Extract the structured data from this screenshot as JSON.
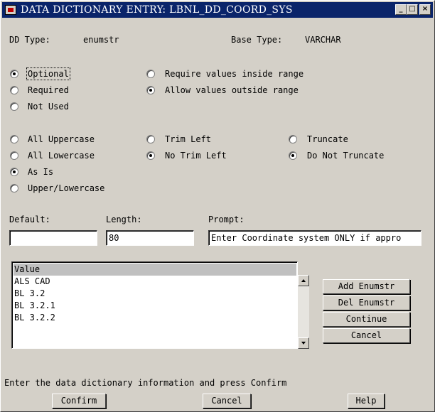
{
  "window": {
    "title": "DATA DICTIONARY ENTRY: LBNL_DD_COORD_SYS",
    "title_bar_color": "#0a246a"
  },
  "title_buttons": {
    "minimize": "_",
    "maximize": "□",
    "close": "×"
  },
  "header": {
    "dd_type_label": "DD Type:",
    "dd_type_value": "enumstr",
    "base_type_label": "Base Type:",
    "base_type_value": "VARCHAR"
  },
  "requirement": {
    "options": [
      "Optional",
      "Required",
      "Not Used"
    ],
    "selected": "Optional"
  },
  "range": {
    "options": [
      "Require values inside range",
      "Allow values outside range"
    ],
    "selected": "Allow values outside range"
  },
  "case": {
    "options": [
      "All Uppercase",
      "All Lowercase",
      "As Is",
      "Upper/Lowercase"
    ],
    "selected": "As Is"
  },
  "trim": {
    "options": [
      "Trim Left",
      "No Trim Left"
    ],
    "selected": "No Trim Left"
  },
  "truncate": {
    "options": [
      "Truncate",
      "Do Not Truncate"
    ],
    "selected": "Do Not Truncate"
  },
  "fields": {
    "default_label": "Default:",
    "default_value": "",
    "length_label": "Length:",
    "length_value": "80",
    "prompt_label": "Prompt:",
    "prompt_value": "Enter Coordinate system ONLY if appro"
  },
  "enum_list": {
    "header": "Value",
    "items": [
      "ALS CAD",
      "BL 3.2",
      "BL 3.2.1",
      "BL 3.2.2"
    ]
  },
  "side_buttons": {
    "add": "Add Enumstr",
    "del": "Del Enumstr",
    "continue": "Continue",
    "cancel": "Cancel"
  },
  "status_text": "Enter the data dictionary information and press Confirm",
  "bottom_buttons": {
    "confirm": "Confirm",
    "cancel": "Cancel",
    "help": "Help"
  }
}
